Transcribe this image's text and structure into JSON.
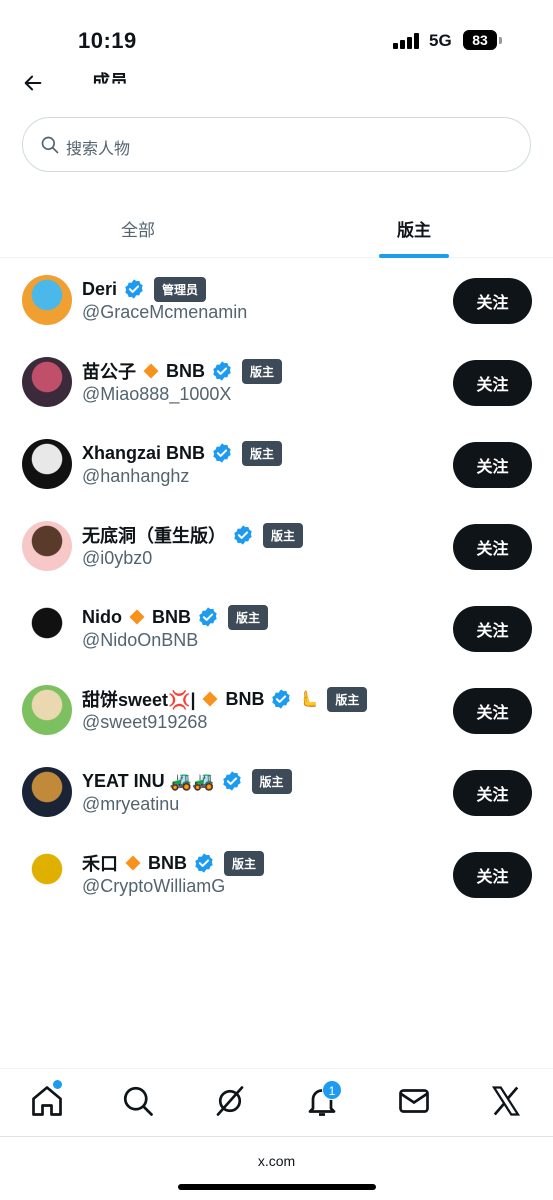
{
  "status": {
    "time": "10:19",
    "network": "5G",
    "battery": "83"
  },
  "header": {
    "title": "成员"
  },
  "search": {
    "placeholder": "搜索人物"
  },
  "tabs": [
    {
      "label": "全部",
      "active": false
    },
    {
      "label": "版主",
      "active": true
    }
  ],
  "members": [
    {
      "name": "Deri",
      "diamond": false,
      "suffix": "",
      "extra_emoji": "",
      "handle": "@GraceMcmenamin",
      "role": "管理员",
      "follow": "关注",
      "avatar_colors": [
        "#f0a030",
        "#4ab8e8"
      ]
    },
    {
      "name": "苗公子",
      "diamond": true,
      "suffix": "BNB",
      "extra_emoji": "",
      "handle": "@Miao888_1000X",
      "role": "版主",
      "follow": "关注",
      "avatar_colors": [
        "#3a2a3a",
        "#c0506a"
      ]
    },
    {
      "name": "Xhangzai BNB",
      "diamond": false,
      "suffix": "",
      "extra_emoji": "",
      "handle": "@hanhanghz",
      "role": "版主",
      "follow": "关注",
      "avatar_colors": [
        "#111111",
        "#e8e8e8"
      ]
    },
    {
      "name": "无底洞（重生版）",
      "diamond": false,
      "suffix": "",
      "extra_emoji": "",
      "handle": "@i0ybz0",
      "role": "版主",
      "follow": "关注",
      "avatar_colors": [
        "#f6c8c8",
        "#5a3a2a"
      ]
    },
    {
      "name": "Nido",
      "diamond": true,
      "suffix": "BNB",
      "extra_emoji": "",
      "handle": "@NidoOnBNB",
      "role": "版主",
      "follow": "关注",
      "avatar_colors": [
        "#ffffff",
        "#111111"
      ]
    },
    {
      "name": "甜饼sweet💢|",
      "diamond": true,
      "suffix": "BNB",
      "extra_emoji": "🫷",
      "handle": "@sweet919268",
      "role": "版主",
      "follow": "关注",
      "avatar_colors": [
        "#7cc060",
        "#e9d8b0"
      ]
    },
    {
      "name": "YEAT INU 🚜🚜",
      "diamond": false,
      "suffix": "",
      "extra_emoji": "",
      "handle": "@mryeatinu",
      "role": "版主",
      "follow": "关注",
      "avatar_colors": [
        "#1b2436",
        "#c08a3a"
      ]
    },
    {
      "name": "禾口",
      "diamond": true,
      "suffix": "BNB",
      "extra_emoji": "",
      "handle": "@CryptoWilliamG",
      "role": "版主",
      "follow": "关注",
      "avatar_colors": [
        "#ffffff",
        "#e0b000"
      ]
    }
  ],
  "nav": {
    "notification_count": "1"
  },
  "browser": {
    "url": "x.com"
  },
  "colors": {
    "accent": "#1d9bf0",
    "badge_bg": "#3d4a57",
    "diamond": "#f7931a"
  }
}
